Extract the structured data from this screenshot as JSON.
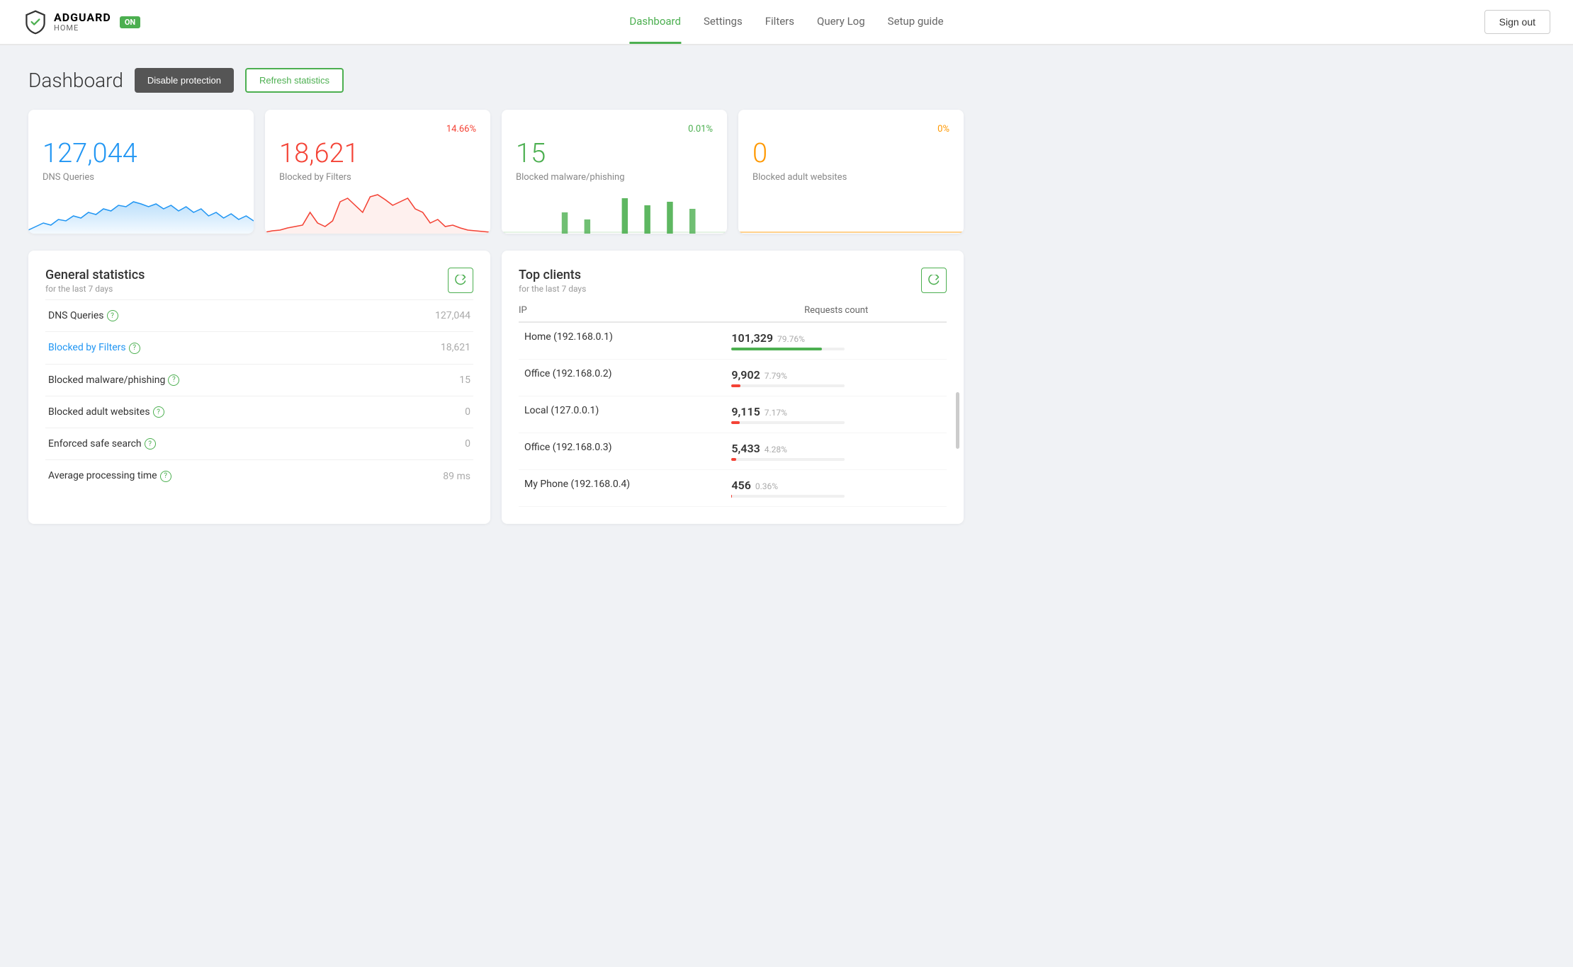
{
  "logo": {
    "brand": "ADGUARD",
    "sub": "HOME",
    "badge": "ON"
  },
  "nav": {
    "items": [
      {
        "label": "Dashboard",
        "active": true
      },
      {
        "label": "Settings",
        "active": false
      },
      {
        "label": "Filters",
        "active": false
      },
      {
        "label": "Query Log",
        "active": false
      },
      {
        "label": "Setup guide",
        "active": false
      }
    ]
  },
  "header": {
    "sign_out": "Sign out"
  },
  "dashboard": {
    "title": "Dashboard",
    "disable_protection": "Disable protection",
    "refresh_statistics": "Refresh statistics"
  },
  "stat_cards": [
    {
      "value": "127,044",
      "label": "DNS Queries",
      "color": "blue",
      "percent": "",
      "percent_color": ""
    },
    {
      "value": "18,621",
      "label": "Blocked by Filters",
      "color": "red",
      "percent": "14.66%",
      "percent_color": "red"
    },
    {
      "value": "15",
      "label": "Blocked malware/phishing",
      "color": "green",
      "percent": "0.01%",
      "percent_color": "green"
    },
    {
      "value": "0",
      "label": "Blocked adult websites",
      "color": "yellow",
      "percent": "0%",
      "percent_color": "yellow"
    }
  ],
  "general_stats": {
    "title": "General statistics",
    "subtitle": "for the last 7 days",
    "rows": [
      {
        "label": "DNS Queries",
        "value": "127,044",
        "is_link": false
      },
      {
        "label": "Blocked by Filters",
        "value": "18,621",
        "is_link": true
      },
      {
        "label": "Blocked malware/phishing",
        "value": "15",
        "is_link": false
      },
      {
        "label": "Blocked adult websites",
        "value": "0",
        "is_link": false
      },
      {
        "label": "Enforced safe search",
        "value": "0",
        "is_link": false
      },
      {
        "label": "Average processing time",
        "value": "89 ms",
        "is_link": false
      }
    ]
  },
  "top_clients": {
    "title": "Top clients",
    "subtitle": "for the last 7 days",
    "col_ip": "IP",
    "col_requests": "Requests count",
    "rows": [
      {
        "name": "Home (192.168.0.1)",
        "count": "101,329",
        "percent": "79.76%",
        "bar_pct": 80,
        "bar_color": "green"
      },
      {
        "name": "Office (192.168.0.2)",
        "count": "9,902",
        "percent": "7.79%",
        "bar_pct": 8,
        "bar_color": "red"
      },
      {
        "name": "Local (127.0.0.1)",
        "count": "9,115",
        "percent": "7.17%",
        "bar_pct": 7,
        "bar_color": "red"
      },
      {
        "name": "Office (192.168.0.3)",
        "count": "5,433",
        "percent": "4.28%",
        "bar_pct": 4,
        "bar_color": "red"
      },
      {
        "name": "My Phone (192.168.0.4)",
        "count": "456",
        "percent": "0.36%",
        "bar_pct": 0.5,
        "bar_color": "red"
      }
    ]
  }
}
